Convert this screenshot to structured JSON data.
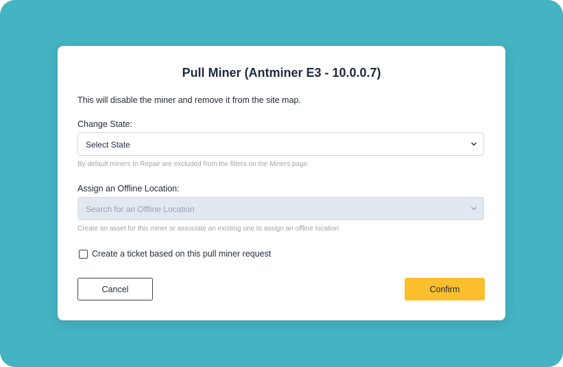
{
  "modal": {
    "title": "Pull Miner (Antminer E3 - 10.0.0.7)",
    "description": "This will disable the miner and remove it from the site map.",
    "change_state": {
      "label": "Change State:",
      "selected": "Select State",
      "hint": "By default miners In Repair are excluded from the filters on the Miners page."
    },
    "offline_location": {
      "label": "Assign an Offline Location:",
      "placeholder": "Search for an Offline Location",
      "hint": "Create an asset for this miner or associate an existing one to assign an offline location",
      "disabled": true
    },
    "ticket_checkbox": {
      "label": "Create a ticket based on this pull miner request",
      "checked": false
    },
    "buttons": {
      "cancel": "Cancel",
      "confirm": "Confirm"
    }
  },
  "colors": {
    "backdrop": "#44b3c2",
    "confirm_button": "#fbbf2d",
    "disabled_field": "#e2e8f0"
  },
  "icons": {
    "select_chevron": "chevron-down-icon"
  }
}
